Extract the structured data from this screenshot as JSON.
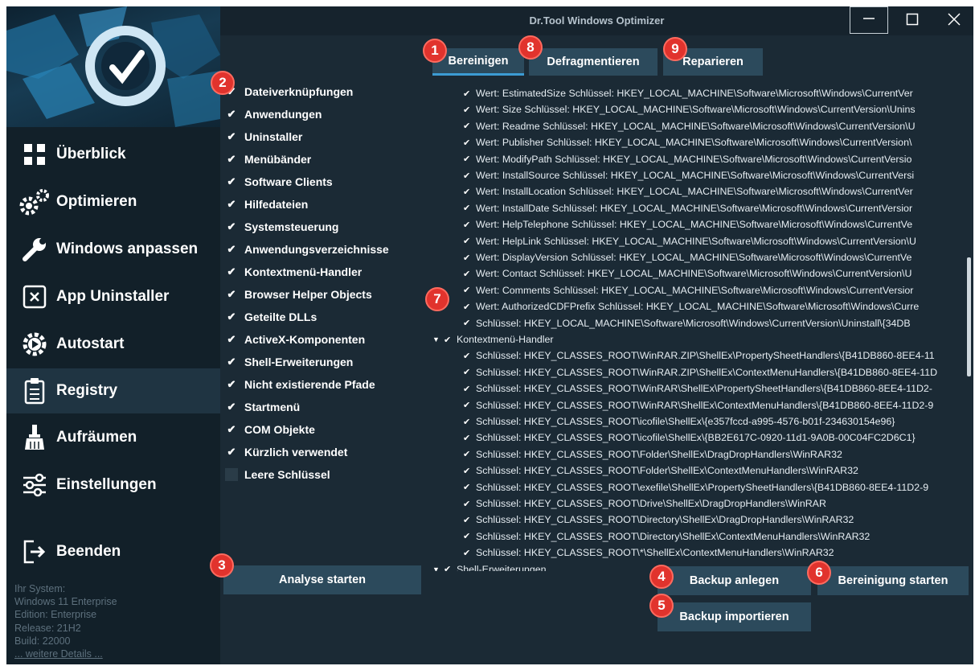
{
  "window": {
    "title": "Dr.Tool Windows Optimizer"
  },
  "colors": {
    "badge": "#e1332d",
    "accent": "#3c9bd3",
    "sidebar": "#122029",
    "panel": "#1b2a35",
    "button": "#2c4a5c"
  },
  "sidebar": {
    "items": [
      {
        "label": "Überblick",
        "icon": "grid-icon"
      },
      {
        "label": "Optimieren",
        "icon": "gears-icon"
      },
      {
        "label": "Windows anpassen",
        "icon": "wrench-icon"
      },
      {
        "label": "App Uninstaller",
        "icon": "uninstall-box-icon"
      },
      {
        "label": "Autostart",
        "icon": "autostart-gear-icon"
      },
      {
        "label": "Registry",
        "icon": "clipboard-icon"
      },
      {
        "label": "Aufräumen",
        "icon": "broom-icon"
      },
      {
        "label": "Einstellungen",
        "icon": "sliders-icon"
      },
      {
        "label": "Beenden",
        "icon": "exit-icon"
      }
    ],
    "active": "Registry",
    "system_info": {
      "heading": "Ihr System:",
      "os": "Windows 11 Enterprise",
      "edition": "Edition: Enterprise",
      "release": "Release: 21H2",
      "build": "Build: 22000",
      "details_link": "... weitere Details ..."
    }
  },
  "tabs": [
    {
      "label": "Bereinigen",
      "active": true
    },
    {
      "label": "Defragmentieren",
      "active": false
    },
    {
      "label": "Reparieren",
      "active": false
    }
  ],
  "categories": [
    {
      "label": "Dateiverknüpfungen",
      "checked": true
    },
    {
      "label": "Anwendungen",
      "checked": true
    },
    {
      "label": "Uninstaller",
      "checked": true
    },
    {
      "label": "Menübänder",
      "checked": true
    },
    {
      "label": "Software Clients",
      "checked": true
    },
    {
      "label": "Hilfedateien",
      "checked": true
    },
    {
      "label": "Systemsteuerung",
      "checked": true
    },
    {
      "label": "Anwendungsverzeichnisse",
      "checked": true
    },
    {
      "label": "Kontextmenü-Handler",
      "checked": true
    },
    {
      "label": "Browser Helper Objects",
      "checked": true
    },
    {
      "label": "Geteilte DLLs",
      "checked": true
    },
    {
      "label": "ActiveX-Komponenten",
      "checked": true
    },
    {
      "label": "Shell-Erweiterungen",
      "checked": true
    },
    {
      "label": "Nicht existierende Pfade",
      "checked": true
    },
    {
      "label": "Startmenü",
      "checked": true
    },
    {
      "label": "COM Objekte",
      "checked": true
    },
    {
      "label": "Kürzlich verwendet",
      "checked": true
    },
    {
      "label": "Leere Schlüssel",
      "checked": false
    }
  ],
  "tree": [
    {
      "level": 1,
      "text": "Wert: EstimatedSize Schlüssel: HKEY_LOCAL_MACHINE\\Software\\Microsoft\\Windows\\CurrentVer"
    },
    {
      "level": 1,
      "text": "Wert: Size Schlüssel: HKEY_LOCAL_MACHINE\\Software\\Microsoft\\Windows\\CurrentVersion\\Unins"
    },
    {
      "level": 1,
      "text": "Wert: Readme Schlüssel: HKEY_LOCAL_MACHINE\\Software\\Microsoft\\Windows\\CurrentVersion\\U"
    },
    {
      "level": 1,
      "text": "Wert: Publisher Schlüssel: HKEY_LOCAL_MACHINE\\Software\\Microsoft\\Windows\\CurrentVersion\\"
    },
    {
      "level": 1,
      "text": "Wert: ModifyPath Schlüssel: HKEY_LOCAL_MACHINE\\Software\\Microsoft\\Windows\\CurrentVersio"
    },
    {
      "level": 1,
      "text": "Wert: InstallSource Schlüssel: HKEY_LOCAL_MACHINE\\Software\\Microsoft\\Windows\\CurrentVersi"
    },
    {
      "level": 1,
      "text": "Wert: InstallLocation Schlüssel: HKEY_LOCAL_MACHINE\\Software\\Microsoft\\Windows\\CurrentVer"
    },
    {
      "level": 1,
      "text": "Wert: InstallDate Schlüssel: HKEY_LOCAL_MACHINE\\Software\\Microsoft\\Windows\\CurrentVersior"
    },
    {
      "level": 1,
      "text": "Wert: HelpTelephone Schlüssel: HKEY_LOCAL_MACHINE\\Software\\Microsoft\\Windows\\CurrentVe"
    },
    {
      "level": 1,
      "text": "Wert: HelpLink Schlüssel: HKEY_LOCAL_MACHINE\\Software\\Microsoft\\Windows\\CurrentVersion\\U"
    },
    {
      "level": 1,
      "text": "Wert: DisplayVersion Schlüssel: HKEY_LOCAL_MACHINE\\Software\\Microsoft\\Windows\\CurrentVe"
    },
    {
      "level": 1,
      "text": "Wert: Contact Schlüssel: HKEY_LOCAL_MACHINE\\Software\\Microsoft\\Windows\\CurrentVersion\\U"
    },
    {
      "level": 1,
      "text": "Wert: Comments Schlüssel: HKEY_LOCAL_MACHINE\\Software\\Microsoft\\Windows\\CurrentVersior"
    },
    {
      "level": 1,
      "text": "Wert: AuthorizedCDFPrefix Schlüssel: HKEY_LOCAL_MACHINE\\Software\\Microsoft\\Windows\\Curre"
    },
    {
      "level": 1,
      "text": "Schlüssel: HKEY_LOCAL_MACHINE\\Software\\Microsoft\\Windows\\CurrentVersion\\Uninstall\\{34DB"
    },
    {
      "level": 0,
      "text": "Kontextmenü-Handler"
    },
    {
      "level": 1,
      "text": "Schlüssel: HKEY_CLASSES_ROOT\\WinRAR.ZIP\\ShellEx\\PropertySheetHandlers\\{B41DB860-8EE4-11"
    },
    {
      "level": 1,
      "text": "Schlüssel: HKEY_CLASSES_ROOT\\WinRAR.ZIP\\ShellEx\\ContextMenuHandlers\\{B41DB860-8EE4-11D"
    },
    {
      "level": 1,
      "text": "Schlüssel: HKEY_CLASSES_ROOT\\WinRAR\\ShellEx\\PropertySheetHandlers\\{B41DB860-8EE4-11D2-"
    },
    {
      "level": 1,
      "text": "Schlüssel: HKEY_CLASSES_ROOT\\WinRAR\\ShellEx\\ContextMenuHandlers\\{B41DB860-8EE4-11D2-9"
    },
    {
      "level": 1,
      "text": "Schlüssel: HKEY_CLASSES_ROOT\\icofile\\ShellEx\\{e357fccd-a995-4576-b01f-234630154e96}"
    },
    {
      "level": 1,
      "text": "Schlüssel: HKEY_CLASSES_ROOT\\icofile\\ShellEx\\{BB2E617C-0920-11d1-9A0B-00C04FC2D6C1}"
    },
    {
      "level": 1,
      "text": "Schlüssel: HKEY_CLASSES_ROOT\\Folder\\ShellEx\\DragDropHandlers\\WinRAR32"
    },
    {
      "level": 1,
      "text": "Schlüssel: HKEY_CLASSES_ROOT\\Folder\\ShellEx\\ContextMenuHandlers\\WinRAR32"
    },
    {
      "level": 1,
      "text": "Schlüssel: HKEY_CLASSES_ROOT\\exefile\\ShellEx\\PropertySheetHandlers\\{B41DB860-8EE4-11D2-9"
    },
    {
      "level": 1,
      "text": "Schlüssel: HKEY_CLASSES_ROOT\\Drive\\ShellEx\\DragDropHandlers\\WinRAR"
    },
    {
      "level": 1,
      "text": "Schlüssel: HKEY_CLASSES_ROOT\\Directory\\ShellEx\\DragDropHandlers\\WinRAR32"
    },
    {
      "level": 1,
      "text": "Schlüssel: HKEY_CLASSES_ROOT\\Directory\\ShellEx\\ContextMenuHandlers\\WinRAR32"
    },
    {
      "level": 1,
      "text": "Schlüssel: HKEY_CLASSES_ROOT\\*\\ShellEx\\ContextMenuHandlers\\WinRAR32"
    },
    {
      "level": 0,
      "text": "Shell-Erweiterungen"
    }
  ],
  "buttons": {
    "analyse": "Analyse starten",
    "backup_create": "Backup anlegen",
    "backup_import": "Backup importieren",
    "clean": "Bereinigung starten"
  },
  "badges": [
    "1",
    "2",
    "3",
    "4",
    "5",
    "6",
    "7",
    "8",
    "9"
  ]
}
